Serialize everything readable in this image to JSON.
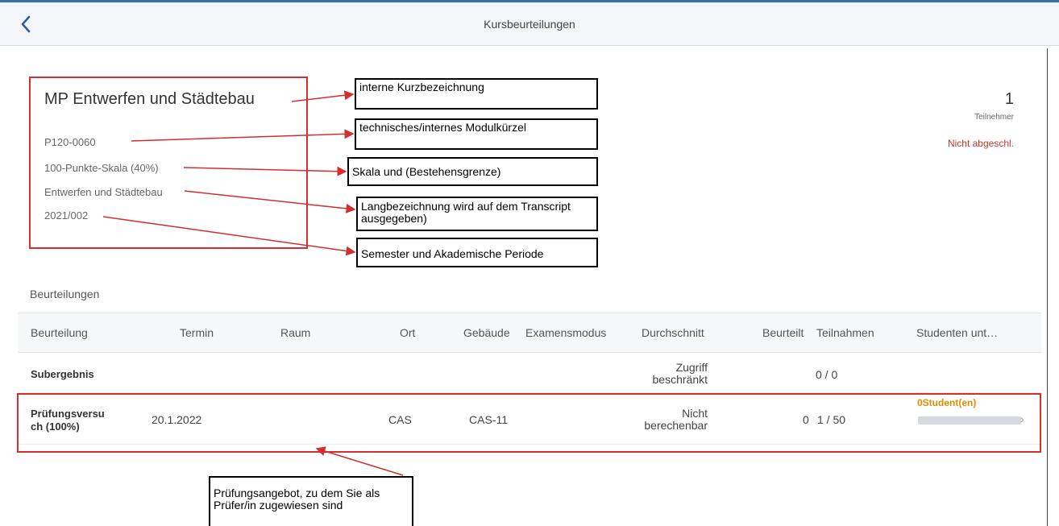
{
  "header": {
    "title": "Kursbeurteilungen"
  },
  "course": {
    "title": "MP Entwerfen und Städtebau",
    "code": "P120-0060",
    "scale": "100-Punkte-Skala (40%)",
    "long_name": "Entwerfen und Städtebau",
    "period": "2021/002"
  },
  "summary": {
    "participants": "1",
    "participants_label": "Teilnehmer",
    "status": "Nicht abgeschl."
  },
  "annotations": {
    "a1": "interne Kurzbezeichnung",
    "a2": "technisches/internes Modulkürzel",
    "a3": "Skala und (Bestehensgrenze)",
    "a4": "Langbezeichnung wird auf dem Transcript ausgegeben)",
    "a5": "Semester und Akademische Periode",
    "a6": "Prüfungsangebot, zu dem Sie als Prüfer/in zugewiesen sind"
  },
  "table": {
    "section_label": "Beurteilungen",
    "headers": {
      "beurteilung": "Beurteilung",
      "termin": "Termin",
      "raum": "Raum",
      "ort": "Ort",
      "gebaeude": "Gebäude",
      "examensmodus": "Examensmodus",
      "durchschnitt": "Durchschnitt",
      "beurteilt": "Beurteilt",
      "teilnahmen": "Teilnahmen",
      "studenten": "Studenten unt…"
    },
    "rows": [
      {
        "beurteilung": "Subergebnis",
        "durchschnitt_1": "Zugriff",
        "durchschnitt_2": "beschränkt",
        "teilnahmen": "0 / 0"
      },
      {
        "beurteilung_1": "Prüfungsversu",
        "beurteilung_2": "ch (100%)",
        "termin": "20.1.2022",
        "ort": "CAS",
        "gebaeude": "CAS-11",
        "durchschnitt_1": "Nicht",
        "durchschnitt_2": "berechenbar",
        "beurteilt": "0",
        "teilnahmen": "1 / 50",
        "studenten": "0Student(en)",
        "progress": 0
      }
    ]
  },
  "colors": {
    "accent": "#3b6ea8",
    "annotation_red": "#d32f2f",
    "status_red": "#c0392b",
    "orange": "#e38b00"
  }
}
